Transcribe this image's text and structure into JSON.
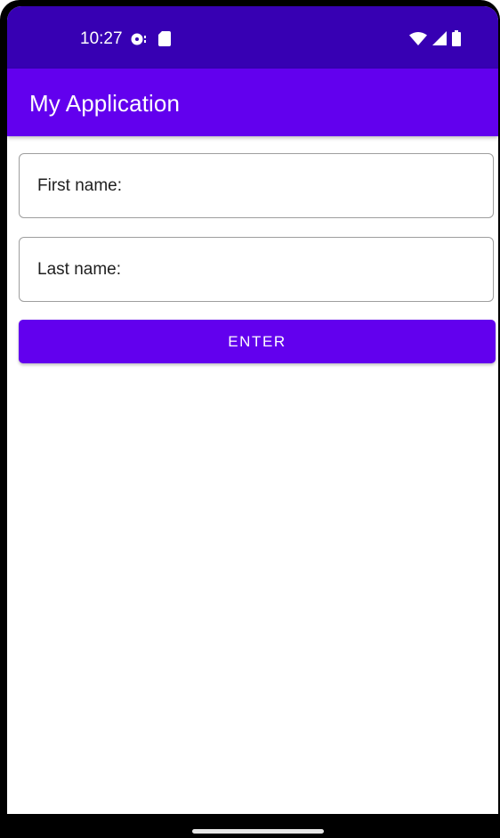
{
  "status_bar": {
    "time": "10:27",
    "left_icons": [
      "sync-disc-icon",
      "sd-card-icon"
    ],
    "right_icons": [
      "wifi-icon",
      "cellular-signal-icon",
      "battery-icon"
    ]
  },
  "app_bar": {
    "title": "My Application"
  },
  "form": {
    "first_name_placeholder": "First name:",
    "last_name_placeholder": "Last name:",
    "enter_label": "ENTER"
  },
  "colors": {
    "status_bar": "#3700b3",
    "primary": "#6200ee",
    "on_primary": "#ffffff"
  }
}
